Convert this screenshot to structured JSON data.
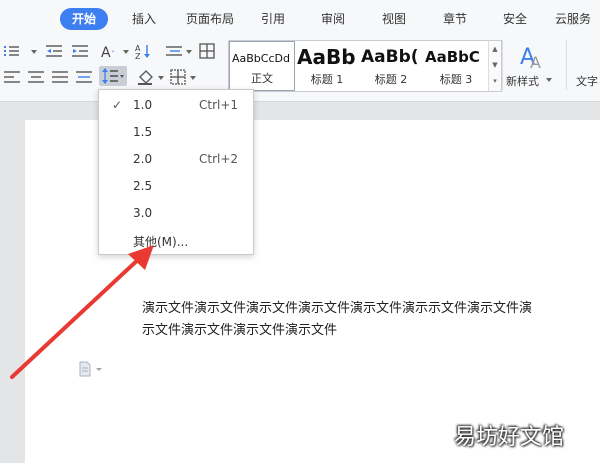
{
  "tabs": [
    "开始",
    "插入",
    "页面布局",
    "引用",
    "审阅",
    "视图",
    "章节",
    "安全",
    "云服务"
  ],
  "active_tab": "开始",
  "styles": [
    {
      "preview": "AaBbCcDd",
      "label": "正文"
    },
    {
      "preview": "AaBb",
      "label": "标题 1"
    },
    {
      "preview": "AaBb(",
      "label": "标题 2"
    },
    {
      "preview": "AaBbC",
      "label": "标题 3"
    }
  ],
  "new_style_label": "新样式",
  "text_tool_label": "文字",
  "line_spacing_menu": {
    "selected": "1.0",
    "items": [
      {
        "value": "1.0",
        "shortcut": "Ctrl+1",
        "checked": true
      },
      {
        "value": "1.5",
        "shortcut": ""
      },
      {
        "value": "2.0",
        "shortcut": "Ctrl+2"
      },
      {
        "value": "2.5",
        "shortcut": ""
      },
      {
        "value": "3.0",
        "shortcut": ""
      },
      {
        "value": "其他(M)...",
        "shortcut": ""
      }
    ]
  },
  "document": {
    "line1": "演示文件演示文件演示文件演示文件演示文件演示示文件演示文件演",
    "line2": "示文件演示文件演示文件演示文件"
  },
  "watermark": "易坊好文馆",
  "colors": {
    "active_tab": "#3d7ef0",
    "arrow": "#e83a33"
  },
  "icons": {
    "check": "✓"
  }
}
